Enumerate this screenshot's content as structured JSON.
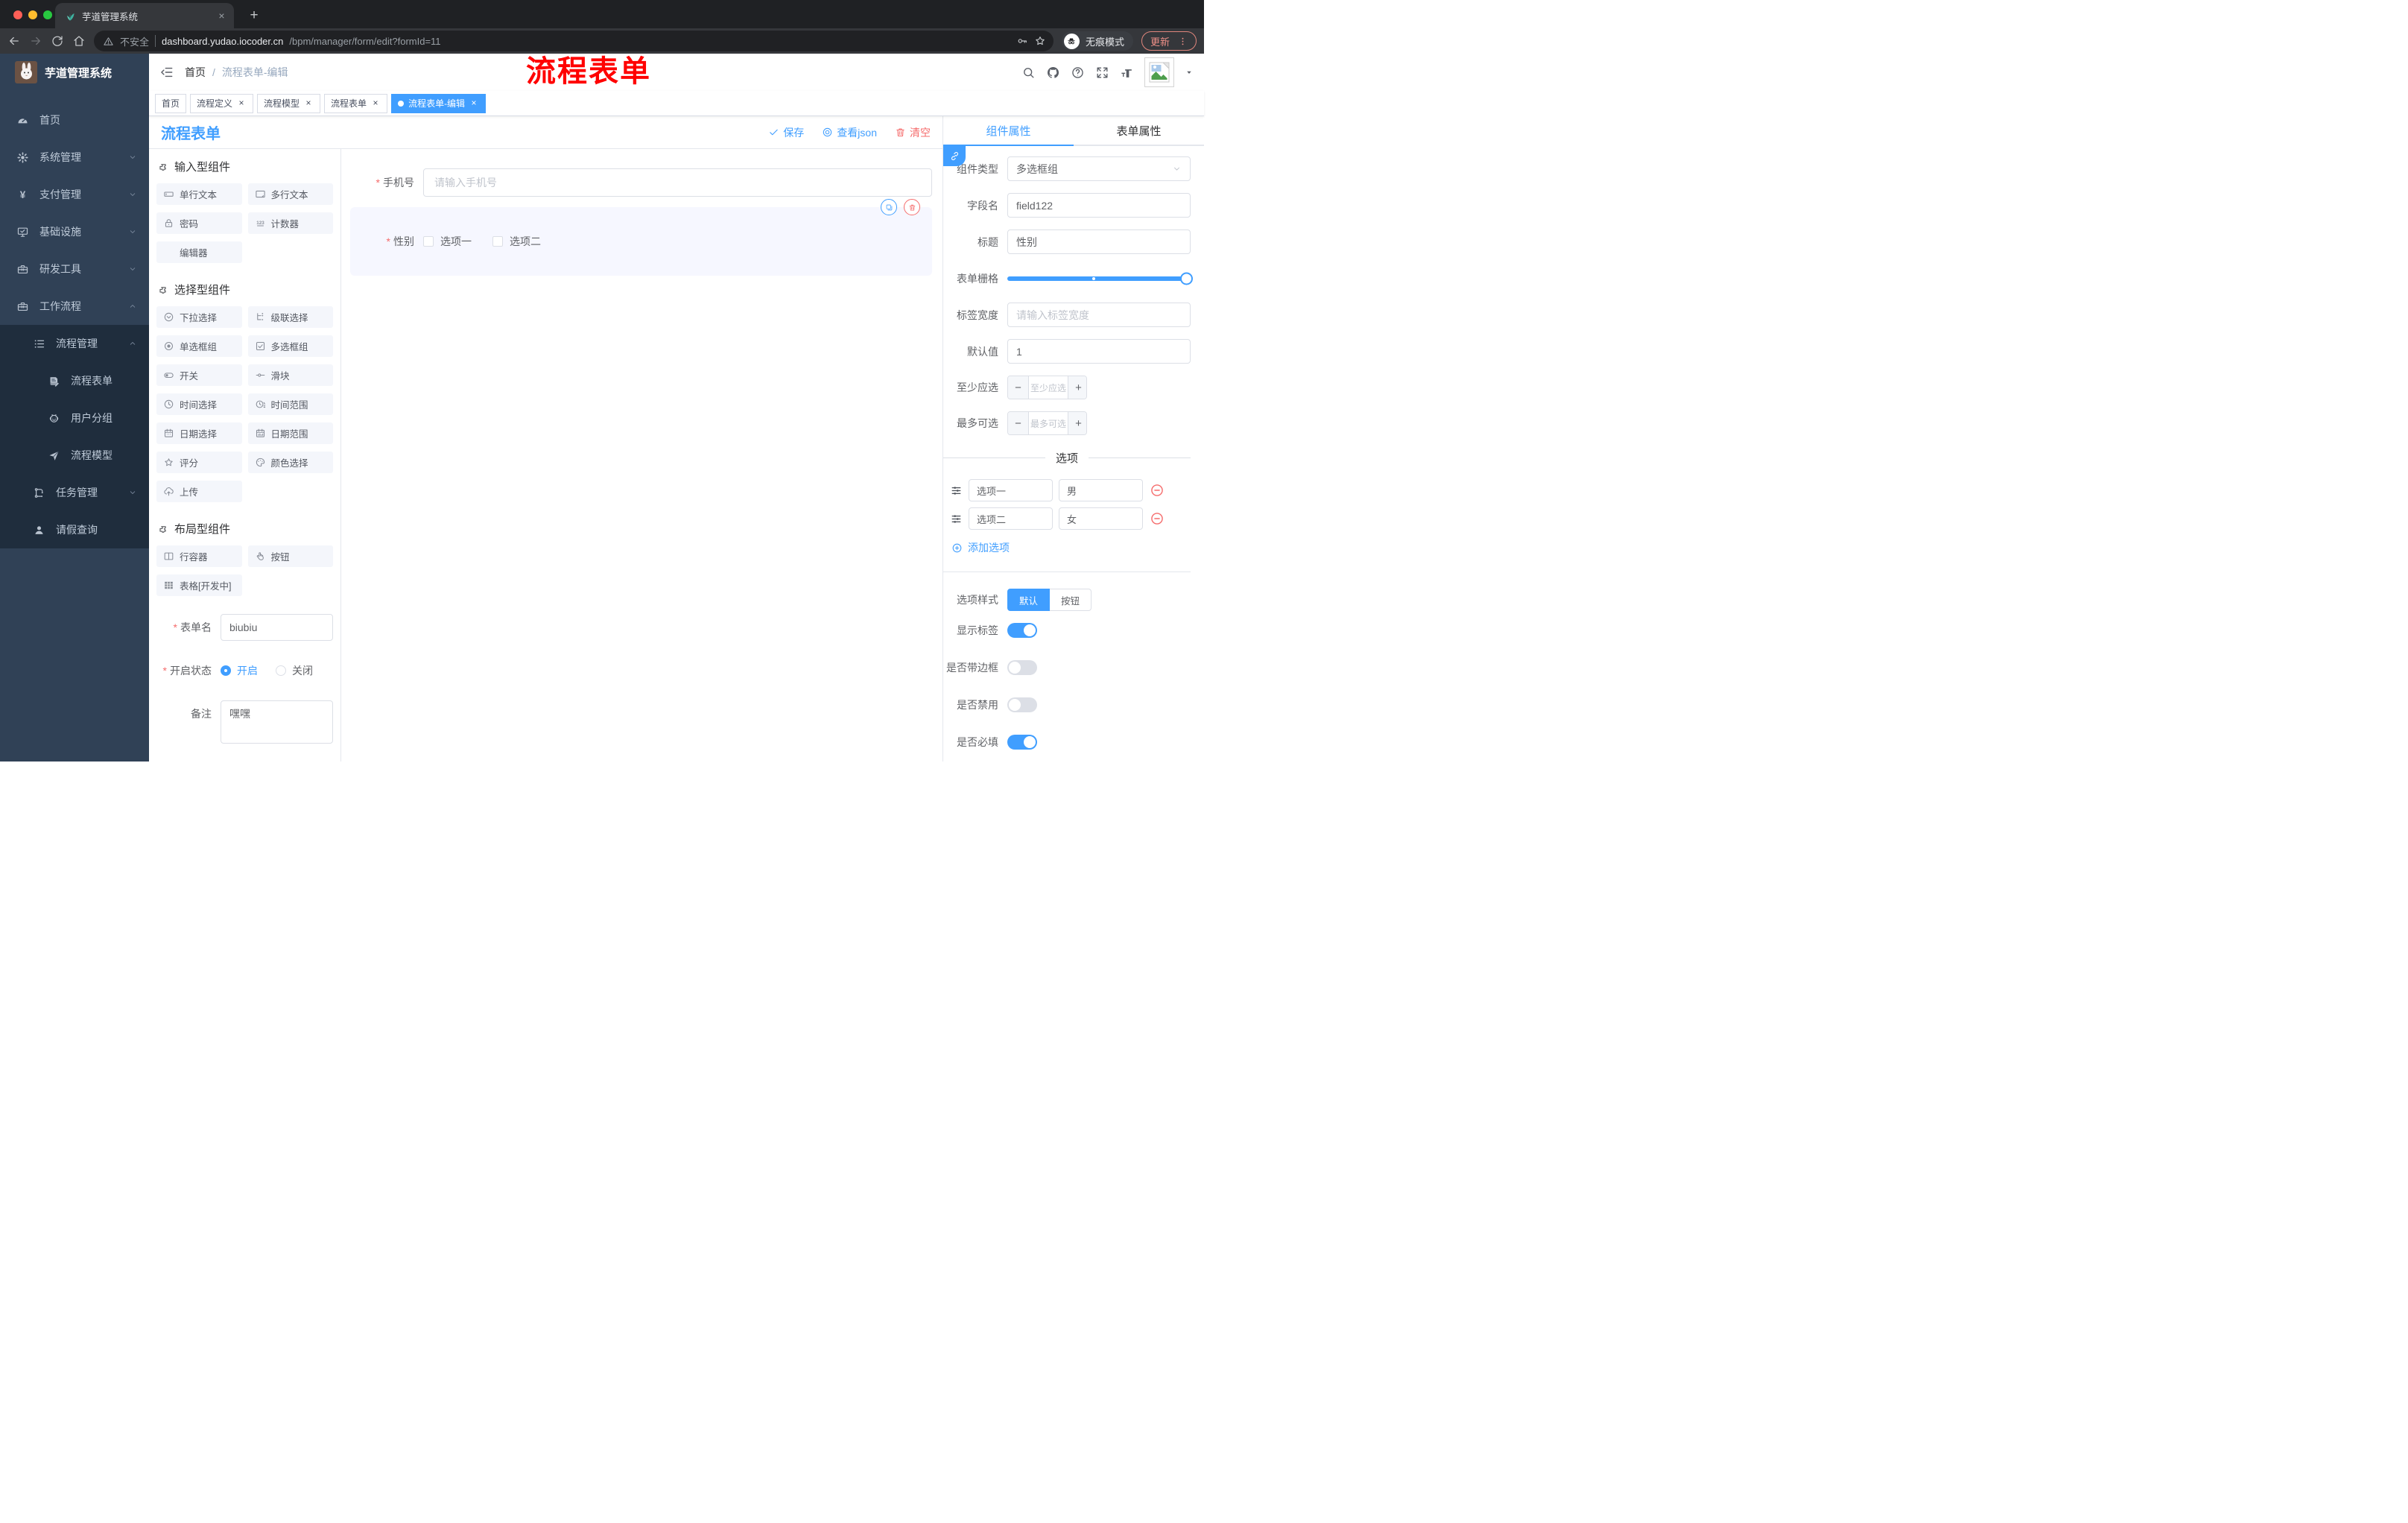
{
  "theme": {
    "accent": "#409eff",
    "danger": "#f56c6c",
    "overlay_red": "#ff0000",
    "sidebar_bg": "#304156",
    "submenu_bg": "#1f2d3d"
  },
  "browser": {
    "tab_title": "芋道管理系统",
    "security": "不安全",
    "url_host": "dashboard.yudao.iocoder.cn",
    "url_path": "/bpm/manager/form/edit?formId=11",
    "incognito": "无痕模式",
    "update": "更新"
  },
  "sidebar": {
    "title": "芋道管理系统",
    "menu": [
      {
        "icon": "dashboard-icon",
        "label": "首页",
        "chevron": null
      },
      {
        "icon": "gear-icon",
        "label": "系统管理",
        "chevron": "down"
      },
      {
        "icon": "yen-icon",
        "label": "支付管理",
        "chevron": "down"
      },
      {
        "icon": "monitor-icon",
        "label": "基础设施",
        "chevron": "down"
      },
      {
        "icon": "toolbox-icon",
        "label": "研发工具",
        "chevron": "down"
      },
      {
        "icon": "briefcase-icon",
        "label": "工作流程",
        "chevron": "up"
      }
    ],
    "submenu": [
      {
        "icon": "flow-list-icon",
        "label": "流程管理",
        "level": 2,
        "chevron": "up"
      },
      {
        "icon": "doc-edit-icon",
        "label": "流程表单",
        "level": 3,
        "chevron": null
      },
      {
        "icon": "robot-icon",
        "label": "用户分组",
        "level": 3,
        "chevron": null
      },
      {
        "icon": "send-icon",
        "label": "流程模型",
        "level": 3,
        "chevron": null
      },
      {
        "icon": "tree-icon",
        "label": "任务管理",
        "level": 2,
        "chevron": "down"
      },
      {
        "icon": "user-icon",
        "label": "请假查询",
        "level": 2,
        "chevron": null
      }
    ]
  },
  "header": {
    "breadcrumb_home": "首页",
    "breadcrumb_sep": "/",
    "breadcrumb_current": "流程表单-编辑",
    "overlay_title": "流程表单"
  },
  "tags": [
    {
      "label": "首页",
      "active": false,
      "closable": false
    },
    {
      "label": "流程定义",
      "active": false,
      "closable": true
    },
    {
      "label": "流程模型",
      "active": false,
      "closable": true
    },
    {
      "label": "流程表单",
      "active": false,
      "closable": true
    },
    {
      "label": "流程表单-编辑",
      "active": true,
      "closable": true
    }
  ],
  "designer": {
    "page_title": "流程表单",
    "actions": {
      "save": "保存",
      "view_json": "查看json",
      "clear": "清空"
    },
    "palette_sections": [
      {
        "title": "输入型组件",
        "items": [
          {
            "icon": "input-icon",
            "label": "单行文本"
          },
          {
            "icon": "textarea-icon",
            "label": "多行文本"
          },
          {
            "icon": "password-icon",
            "label": "密码"
          },
          {
            "icon": "counter-icon",
            "label": "计数器"
          },
          {
            "icon": null,
            "label": "编辑器"
          }
        ]
      },
      {
        "title": "选择型组件",
        "items": [
          {
            "icon": "select-icon",
            "label": "下拉选择"
          },
          {
            "icon": "cascader-icon",
            "label": "级联选择"
          },
          {
            "icon": "radio-icon",
            "label": "单选框组"
          },
          {
            "icon": "checkbox-icon",
            "label": "多选框组"
          },
          {
            "icon": "switch-icon",
            "label": "开关"
          },
          {
            "icon": "slider-icon",
            "label": "滑块"
          },
          {
            "icon": "time-icon",
            "label": "时间选择"
          },
          {
            "icon": "time-range-icon",
            "label": "时间范围"
          },
          {
            "icon": "date-icon",
            "label": "日期选择"
          },
          {
            "icon": "date-range-icon",
            "label": "日期范围"
          },
          {
            "icon": "rate-icon",
            "label": "评分"
          },
          {
            "icon": "color-icon",
            "label": "颜色选择"
          },
          {
            "icon": "upload-icon",
            "label": "上传"
          }
        ]
      },
      {
        "title": "布局型组件",
        "items": [
          {
            "icon": "row-icon",
            "label": "行容器"
          },
          {
            "icon": "button-icon",
            "label": "按钮"
          },
          {
            "icon": "table-icon",
            "label": "表格[开发中]"
          }
        ]
      }
    ],
    "meta": {
      "form_name_label": "表单名",
      "form_name_value": "biubiu",
      "status_label": "开启状态",
      "status_options": [
        {
          "label": "开启",
          "checked": true
        },
        {
          "label": "关闭",
          "checked": false
        }
      ],
      "remark_label": "备注",
      "remark_value": "嘿嘿"
    },
    "canvas": {
      "phone": {
        "label": "手机号",
        "placeholder": "请输入手机号"
      },
      "gender": {
        "label": "性别",
        "options": [
          "选项一",
          "选项二"
        ]
      }
    }
  },
  "props": {
    "tabs": [
      {
        "label": "组件属性",
        "active": true
      },
      {
        "label": "表单属性",
        "active": false
      }
    ],
    "component_type": {
      "label": "组件类型",
      "value": "多选框组"
    },
    "field_name": {
      "label": "字段名",
      "value": "field122"
    },
    "title_row": {
      "label": "标题",
      "value": "性别"
    },
    "grid_row": {
      "label": "表单栅格"
    },
    "label_width": {
      "label": "标签宽度",
      "placeholder": "请输入标签宽度"
    },
    "default_value": {
      "label": "默认值",
      "value": "1"
    },
    "min_select": {
      "label": "至少应选",
      "placeholder": "至少应选"
    },
    "max_select": {
      "label": "最多可选",
      "placeholder": "最多可选"
    },
    "options_title": "选项",
    "options": [
      {
        "label": "选项一",
        "value": "男"
      },
      {
        "label": "选项二",
        "value": "女"
      }
    ],
    "add_option": "添加选项",
    "option_style": {
      "label": "选项样式",
      "choices": [
        {
          "label": "默认",
          "active": true
        },
        {
          "label": "按钮",
          "active": false
        }
      ]
    },
    "switches": [
      {
        "label": "显示标签",
        "on": true
      },
      {
        "label": "是否带边框",
        "on": false
      },
      {
        "label": "是否禁用",
        "on": false
      },
      {
        "label": "是否必填",
        "on": true
      }
    ]
  }
}
